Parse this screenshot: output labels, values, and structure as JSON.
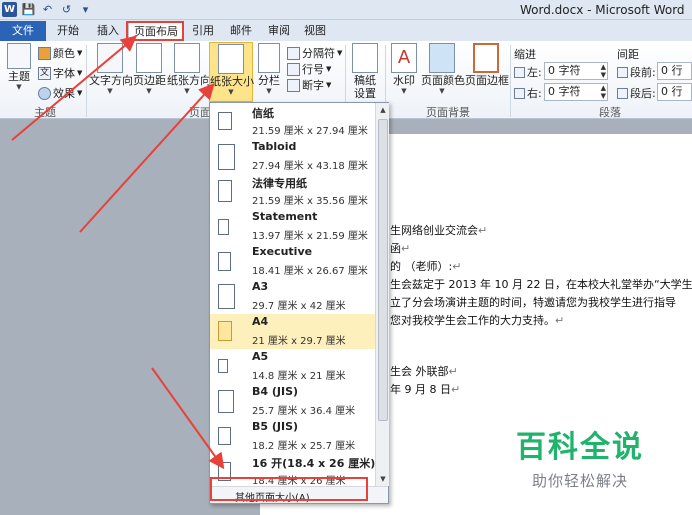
{
  "window": {
    "title": "Word.docx - Microsoft Word",
    "app_icon": "W"
  },
  "quick_access": [
    "save-icon",
    "undo-icon",
    "redo-icon",
    "customize-icon"
  ],
  "tabs": [
    {
      "label": "文件"
    },
    {
      "label": "开始"
    },
    {
      "label": "插入"
    },
    {
      "label": "页面布局"
    },
    {
      "label": "引用"
    },
    {
      "label": "邮件"
    },
    {
      "label": "审阅"
    },
    {
      "label": "视图"
    }
  ],
  "ribbon": {
    "theme": {
      "label": "主题",
      "colors": "颜色",
      "fonts": "字体",
      "effects": "效果",
      "group": "主题"
    },
    "page_setup": {
      "text_direction": "文字方向",
      "margins": "页边距",
      "orientation": "纸张方向",
      "size": "纸张大小",
      "columns": "分栏",
      "breaks": "分隔符",
      "line_numbers": "行号",
      "hyphenation": "断字",
      "group": "页面"
    },
    "manuscript": {
      "label1": "稿纸",
      "label2": "设置"
    },
    "background": {
      "watermark": "水印",
      "page_color": "页面颜色",
      "page_borders": "页面边框",
      "group": "页面背景"
    },
    "paragraph": {
      "indent": "缩进",
      "left_label": "左:",
      "left_value": "0 字符",
      "right_label": "右:",
      "right_value": "0 字符",
      "spacing": "间距",
      "before_label": "段前:",
      "before_value": "0 行",
      "after_label": "段后:",
      "after_value": "0 行",
      "group": "段落"
    }
  },
  "paper_sizes": [
    {
      "name": "信纸",
      "dims": "21.59 厘米 x 27.94 厘米",
      "selected": false
    },
    {
      "name": "Tabloid",
      "dims": "27.94 厘米 x 43.18 厘米",
      "selected": false
    },
    {
      "name": "法律专用纸",
      "dims": "21.59 厘米 x 35.56 厘米",
      "selected": false
    },
    {
      "name": "Statement",
      "dims": "13.97 厘米 x 21.59 厘米",
      "selected": false
    },
    {
      "name": "Executive",
      "dims": "18.41 厘米 x 26.67 厘米",
      "selected": false
    },
    {
      "name": "A3",
      "dims": "29.7 厘米 x 42 厘米",
      "selected": false
    },
    {
      "name": "A4",
      "dims": "21 厘米 x 29.7 厘米",
      "selected": true
    },
    {
      "name": "A5",
      "dims": "14.8 厘米 x 21 厘米",
      "selected": false
    },
    {
      "name": "B4 (JIS)",
      "dims": "25.7 厘米 x 36.4 厘米",
      "selected": false
    },
    {
      "name": "B5 (JIS)",
      "dims": "18.2 厘米 x 25.7 厘米",
      "selected": false
    },
    {
      "name": "16 开(18.4 x 26 厘米)",
      "dims": "18.4 厘米 x 26 厘米",
      "selected": false
    }
  ],
  "more_sizes": "其他页面大小(A)...",
  "document": {
    "lines": [
      "生网络创业交流会",
      "函",
      "的                （老师）:",
      "生会兹定于 2013 年 10 月 22 日，在本校大礼堂举办“大学生",
      "立了分会场演讲主题的时间，特邀请您为我校学生进行指导",
      "您对我校学生会工作的大力支持。",
      "生会  外联部",
      "年 9 月 8 日"
    ]
  },
  "watermark": {
    "line1": "百科全说",
    "line2": "助你轻松解决"
  },
  "colors": {
    "accent": "#2b579a",
    "file_tab": "#2b63b6",
    "highlight": "#e8413a",
    "selected": "#fde38a",
    "watermark": "#1fb36b"
  }
}
